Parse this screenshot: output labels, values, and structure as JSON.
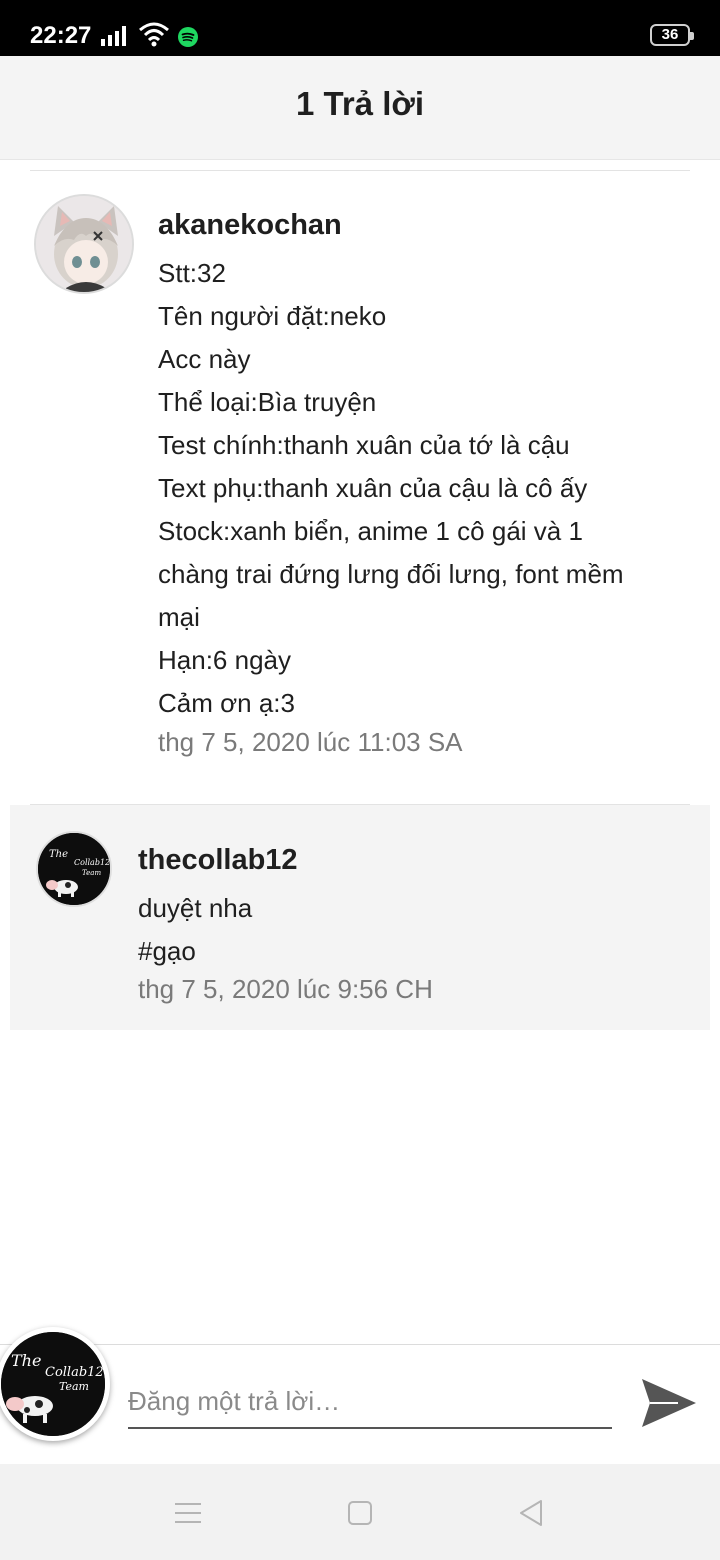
{
  "status_bar": {
    "time": "22:27",
    "battery": "36",
    "icons": [
      "signal-icon",
      "wifi-icon",
      "spotify-icon",
      "battery-icon"
    ]
  },
  "header": {
    "title": "1 Trả lời"
  },
  "comments": [
    {
      "username": "akanekochan",
      "lines": [
        "Stt:32",
        "Tên người đặt:neko",
        "Acc này",
        "Thể loại:Bìa truyện",
        "Test chính:thanh xuân của tớ là cậu",
        "Text phụ:thanh xuân của cậu là cô ấy",
        "Stock:xanh biển, anime 1 cô gái và 1",
        "chàng trai đứng lưng đối lưng, font mềm",
        "mại",
        "Hạn:6 ngày",
        "Cảm ơn ạ:3"
      ],
      "timestamp": "thg 7 5, 2020 lúc 11:03 SA"
    },
    {
      "username": "thecollab12",
      "lines": [
        "duyệt nha",
        "#gạo"
      ],
      "timestamp": "thg 7 5, 2020 lúc 9:56 CH"
    }
  ],
  "compose": {
    "placeholder": "Đăng một trả lời…",
    "avatar_logo_text": [
      "The",
      "Collab12",
      "Team"
    ]
  },
  "colors": {
    "header_bg": "#f4f4f4",
    "reply_bg": "#f4f4f4",
    "text": "#1f1f1f",
    "muted": "#7a7a7a"
  }
}
